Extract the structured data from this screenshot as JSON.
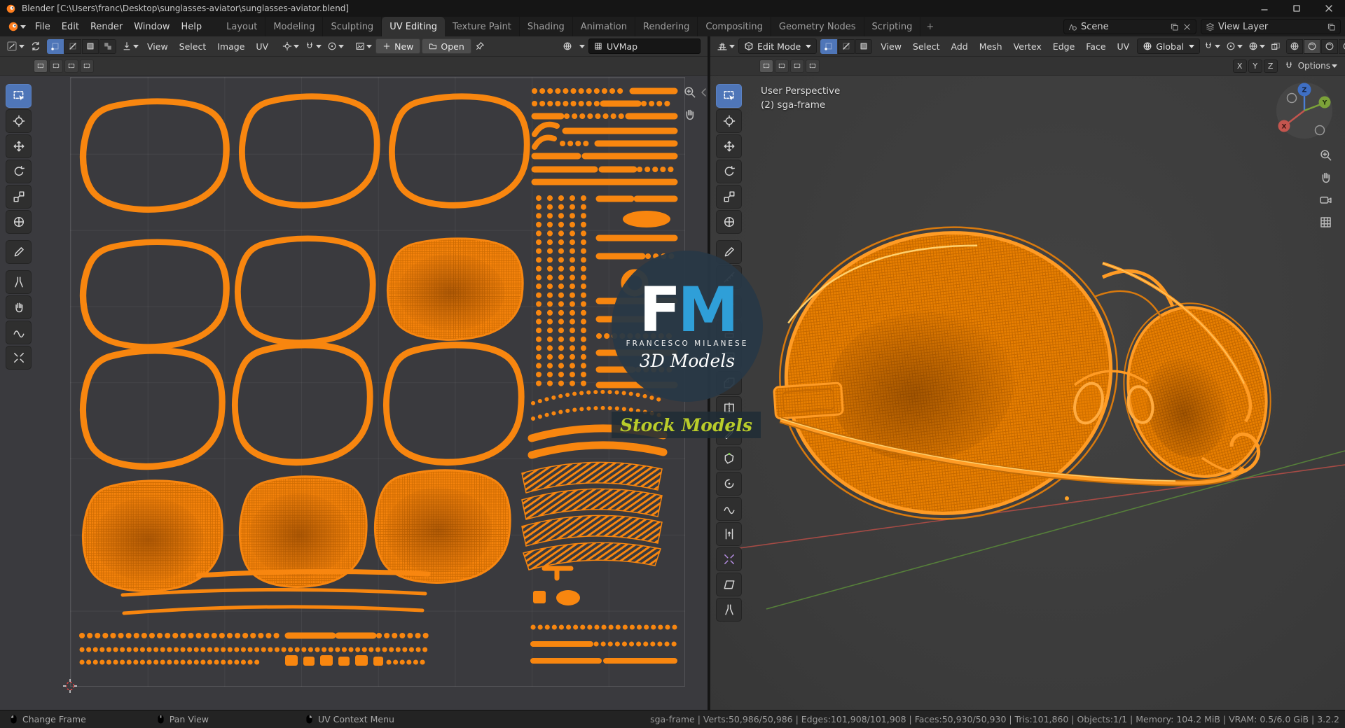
{
  "window": {
    "title": "Blender [C:\\Users\\franc\\Desktop\\sunglasses-aviator\\sunglasses-aviator.blend]"
  },
  "topbar": {
    "menus": [
      "File",
      "Edit",
      "Render",
      "Window",
      "Help"
    ],
    "tabs": [
      "Layout",
      "Modeling",
      "Sculpting",
      "UV Editing",
      "Texture Paint",
      "Shading",
      "Animation",
      "Rendering",
      "Compositing",
      "Geometry Nodes",
      "Scripting"
    ],
    "add_tab": "+",
    "scene_label": "Scene",
    "view_layer_label": "View Layer"
  },
  "uv_editor": {
    "menus": [
      "View",
      "Select",
      "Image",
      "UV"
    ],
    "new_button": "New",
    "open_button": "Open",
    "uv_map": "UVMap"
  },
  "viewport": {
    "mode": "Edit Mode",
    "menus": [
      "View",
      "Select",
      "Add",
      "Mesh",
      "Vertex",
      "Edge",
      "Face",
      "UV"
    ],
    "orientation": "Global",
    "options": "Options",
    "mirror": [
      "X",
      "Y",
      "Z"
    ],
    "overlay": {
      "line1": "User Perspective",
      "line2": "(2) sga-frame"
    },
    "gizmo": {
      "x": "X",
      "y": "Y",
      "z": "Z"
    }
  },
  "watermark": {
    "initial_f": "F",
    "initial_m": "M",
    "name": "FRANCESCO MILANESE",
    "tagline": "3D Models",
    "banner": "Stock Models"
  },
  "statusbar": {
    "hints": [
      "Change Frame",
      "Pan View",
      "UV Context Menu"
    ],
    "stats": "sga-frame | Verts:50,986/50,986 | Edges:101,908/101,908 | Faces:50,930/50,930 | Tris:101,860 | Objects:1/1 | Memory: 104.2 MiB | VRAM: 0.5/6.0 GiB | 3.2.2"
  },
  "colors": {
    "selection_orange": "#f8860f",
    "active_tool_blue": "#4f76b8",
    "fm_blue": "#2f9fd8",
    "stock_green": "#b9cc2a"
  }
}
